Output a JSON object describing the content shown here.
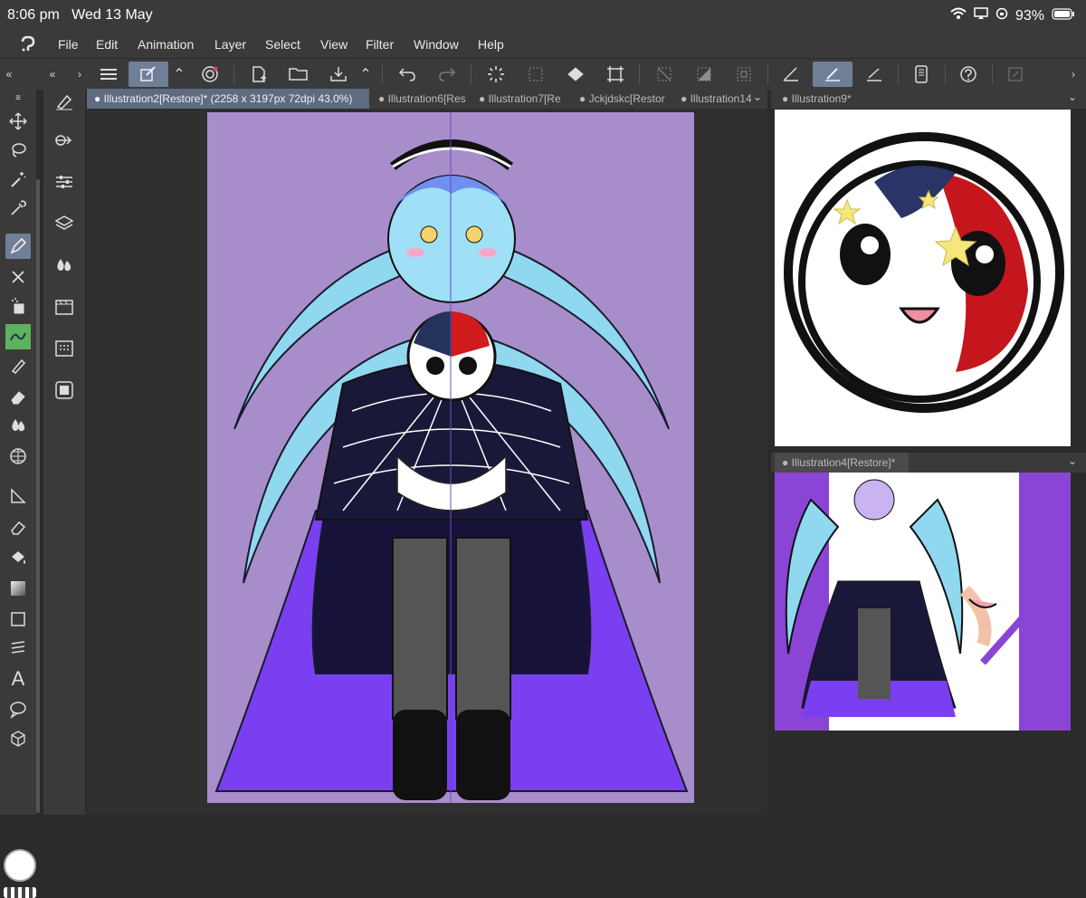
{
  "status": {
    "time": "8:06 pm",
    "date": "Wed 13 May",
    "battery": "93%"
  },
  "menu": {
    "items": [
      "File",
      "Edit",
      "Animation",
      "Layer",
      "Select",
      "View",
      "Filter",
      "Window",
      "Help"
    ]
  },
  "tabs": {
    "main": [
      "Illustration2[Restore]* (2258 x 3197px 72dpi 43.0%)",
      "Illustration6[Res",
      "Illustration7[Re",
      "Jckjdskc[Restor",
      "Illustration14"
    ],
    "sub1": "Illustration9*",
    "sub2": "Illustration4[Restore]*"
  },
  "icons": {
    "app_logo": "clip-studio-logo-icon",
    "wifi": "wifi-icon",
    "battery": "battery-icon"
  },
  "colors": {
    "canvas_bg": "#a78ecb",
    "active_tab": "#5e6b80",
    "active_tool": "#6f7f98",
    "ui_dark": "#3a3a3a"
  }
}
